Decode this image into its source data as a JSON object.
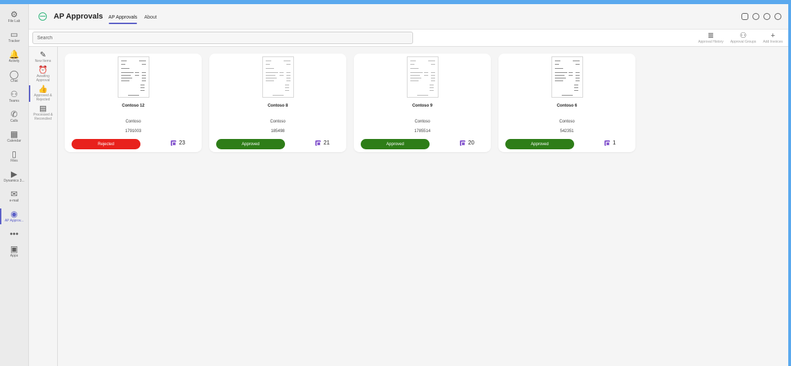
{
  "rail": [
    {
      "label": "File Lab",
      "icon": "gear-icon",
      "glyph": "⚙"
    },
    {
      "label": "Tracker",
      "icon": "tracker-icon",
      "glyph": "▭"
    },
    {
      "label": "Activity",
      "icon": "bell-icon",
      "glyph": "🔔"
    },
    {
      "label": "Chat",
      "icon": "chat-icon",
      "glyph": "◯"
    },
    {
      "label": "Teams",
      "icon": "teams-icon",
      "glyph": "⚇"
    },
    {
      "label": "Calls",
      "icon": "phone-icon",
      "glyph": "✆"
    },
    {
      "label": "Calendar",
      "icon": "calendar-icon",
      "glyph": "▦"
    },
    {
      "label": "Files",
      "icon": "file-icon",
      "glyph": "▯"
    },
    {
      "label": "Dynamics 3...",
      "icon": "dynamics-icon",
      "glyph": "▶"
    },
    {
      "label": "e-mail",
      "icon": "email-icon",
      "glyph": "✉"
    },
    {
      "label": "AP Approv...",
      "icon": "ap-approvals-icon",
      "glyph": "◉",
      "active": true
    },
    {
      "label": "",
      "icon": "more-icon",
      "glyph": "•••"
    },
    {
      "label": "Apps",
      "icon": "apps-icon",
      "glyph": "▣"
    }
  ],
  "header": {
    "title": "AP Approvals",
    "tabs": [
      {
        "label": "AP Approvals",
        "active": true
      },
      {
        "label": "About",
        "active": false
      }
    ]
  },
  "search": {
    "placeholder": "Search"
  },
  "commands": [
    {
      "label": "Approval History",
      "icon": "list-icon",
      "glyph": "≣"
    },
    {
      "label": "Approval Groups",
      "icon": "people-icon",
      "glyph": "⚇"
    },
    {
      "label": "Add Invoices",
      "icon": "plus-icon",
      "glyph": "+"
    }
  ],
  "nav": [
    {
      "label": "New Items",
      "icon": "new-items-icon",
      "glyph": "✎"
    },
    {
      "label": "Awaiting Approval",
      "icon": "alarm-icon",
      "glyph": "⏰"
    },
    {
      "label": "Approved & Rejected",
      "icon": "thumbs-up-icon",
      "glyph": "👍",
      "active": true
    },
    {
      "label": "Processed & Reconciled",
      "icon": "document-icon",
      "glyph": "▤"
    }
  ],
  "cards": [
    {
      "name": "Contoso 12",
      "vendor": "Contoso",
      "number": "1791003",
      "status": "Rejected",
      "status_kind": "rejected",
      "count": "23"
    },
    {
      "name": "Contoso 8",
      "vendor": "Contoso",
      "number": "185498",
      "status": "Approved",
      "status_kind": "approved",
      "count": "21"
    },
    {
      "name": "Contoso 9",
      "vendor": "Contoso",
      "number": "1785514",
      "status": "Approved",
      "status_kind": "approved",
      "count": "20"
    },
    {
      "name": "Contoso 6",
      "vendor": "Contoso",
      "number": "542351",
      "status": "Approved",
      "status_kind": "approved",
      "count": "1"
    }
  ],
  "colors": {
    "accent": "#5b5fc7",
    "rejected": "#e8211c",
    "approved": "#2e7d18",
    "count_badge": "#8b5fd0"
  }
}
